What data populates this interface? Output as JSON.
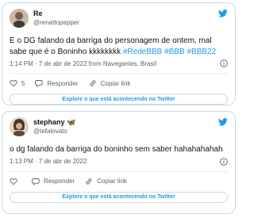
{
  "tweets": [
    {
      "display_name": "Re",
      "handle": "@renattopepper",
      "text_plain": "E o DG falando da barriga do personagem de ontem, mal sabe que é o Boninho kkkkkkkk ",
      "hashtags": "#RedeBBB #BBB #BBB22",
      "time": "1:14 PM · 7 de abr de 2022 from Navegantes, Brasil",
      "likes": "5",
      "reply_label": "Responder",
      "copy_label": "Copiar link",
      "explore_label": "Explore o que está acontecendo no Twitter"
    },
    {
      "display_name": "stephany 🦋",
      "handle": "@tefalovato",
      "text_plain": "o dg falando da barriga do boninho sem saber hahahahahah",
      "hashtags": "",
      "time": "1:13 PM · 7 de abr de 2022",
      "likes": "",
      "reply_label": "Responder",
      "copy_label": "Copiar link",
      "explore_label": "Explore o que está acontecendo no Twitter"
    }
  ],
  "colors": {
    "accent": "#1d9bf0",
    "muted": "#536471",
    "border": "#cfd9de",
    "like": "#536471"
  },
  "icons": [
    "twitter-bird-icon",
    "info-icon",
    "heart-icon",
    "reply-icon",
    "link-icon"
  ]
}
